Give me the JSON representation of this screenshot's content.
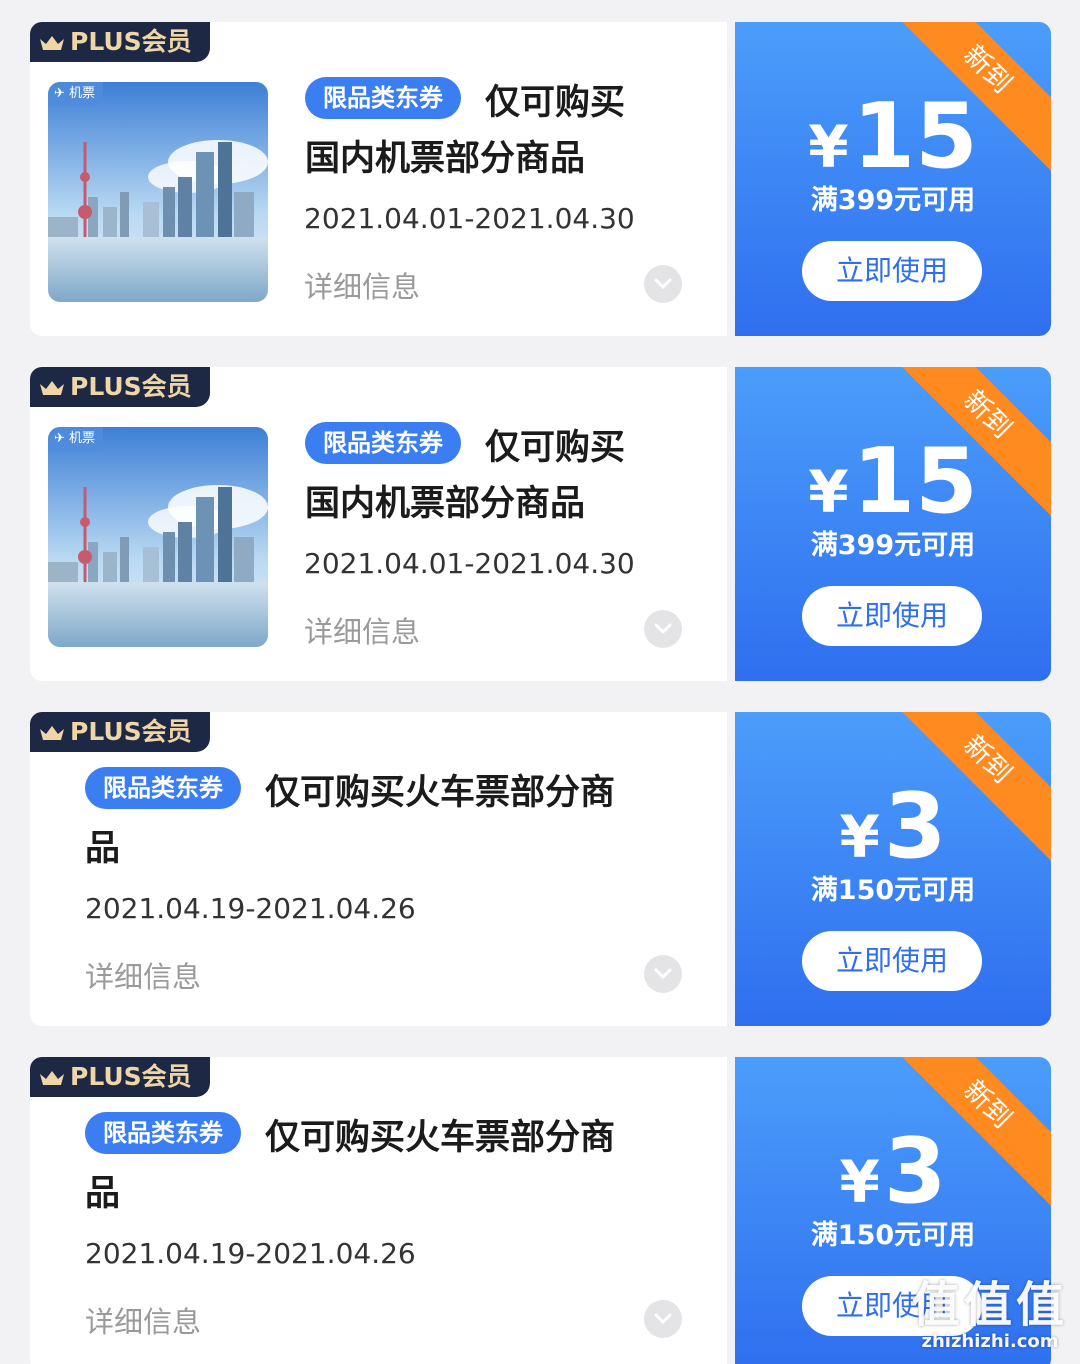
{
  "coupons": [
    {
      "plus_label": "PLUS会员",
      "thumb_tag": "机票",
      "badge": "限品类东券",
      "title_a": "仅可购买",
      "title_b": "国内机票部分商品",
      "date": "2021.04.01-2021.04.30",
      "detail": "详细信息",
      "ribbon": "新到",
      "yen": "¥",
      "amount": "15",
      "condition": "满399元可用",
      "button": "立即使用"
    },
    {
      "plus_label": "PLUS会员",
      "thumb_tag": "机票",
      "badge": "限品类东券",
      "title_a": "仅可购买",
      "title_b": "国内机票部分商品",
      "date": "2021.04.01-2021.04.30",
      "detail": "详细信息",
      "ribbon": "新到",
      "yen": "¥",
      "amount": "15",
      "condition": "满399元可用",
      "button": "立即使用"
    },
    {
      "plus_label": "PLUS会员",
      "badge": "限品类东券",
      "title_a": "仅可购买火车票部分商",
      "title_b": "品",
      "date": "2021.04.19-2021.04.26",
      "detail": "详细信息",
      "ribbon": "新到",
      "yen": "¥",
      "amount": "3",
      "condition": "满150元可用",
      "button": "立即使用"
    },
    {
      "plus_label": "PLUS会员",
      "badge": "限品类东券",
      "title_a": "仅可购买火车票部分商",
      "title_b": "品",
      "date": "2021.04.19-2021.04.26",
      "detail": "详细信息",
      "ribbon": "新到",
      "yen": "¥",
      "amount": "3",
      "condition": "满150元可用",
      "button": "立即使用"
    }
  ],
  "watermark": {
    "big": "值值值",
    "small": "zhizhizhi.com"
  },
  "colors": {
    "accent": "#2f6fef",
    "ribbon": "#ff8a1f",
    "plus_bg": "#1d2844",
    "plus_text": "#f0d6a6"
  }
}
